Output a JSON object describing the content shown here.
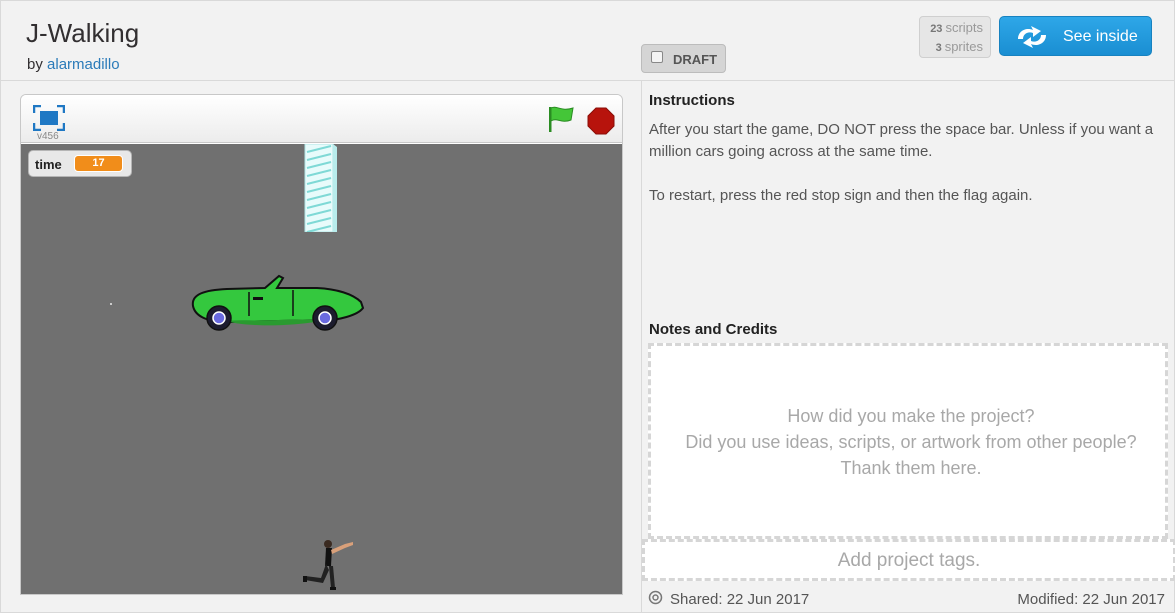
{
  "project": {
    "title": "J-Walking",
    "by_label": "by",
    "author": "alarmadillo"
  },
  "draft": {
    "label": "DRAFT",
    "checked": false
  },
  "stats": {
    "scripts_count": "23",
    "scripts_label": "scripts",
    "sprites_count": "3",
    "sprites_label": "sprites"
  },
  "see_inside": {
    "label": "See inside"
  },
  "player": {
    "version": "v456",
    "variable": {
      "name": "time",
      "value": "17"
    }
  },
  "instructions": {
    "heading": "Instructions",
    "text": "After you start the game, DO NOT press the space bar. Unless if you want a million cars going across at the same time.\n\nTo restart, press the red stop sign and then the flag again."
  },
  "notes": {
    "heading": "Notes and Credits",
    "placeholder": "How did you make the project?\nDid you use ideas, scripts, or artwork from other people? Thank them here."
  },
  "tags": {
    "placeholder": "Add project tags."
  },
  "footer": {
    "shared": "Shared: 22 Jun 2017",
    "modified": "Modified: 22 Jun 2017"
  },
  "colors": {
    "accent": "#1a8ed2",
    "variable": "#f18d1a",
    "stage": "#707070",
    "car": "#2ecc40"
  },
  "icons": [
    "fullscreen-icon",
    "green-flag-icon",
    "stop-sign-icon",
    "remix-arrows-icon",
    "shared-icon"
  ]
}
